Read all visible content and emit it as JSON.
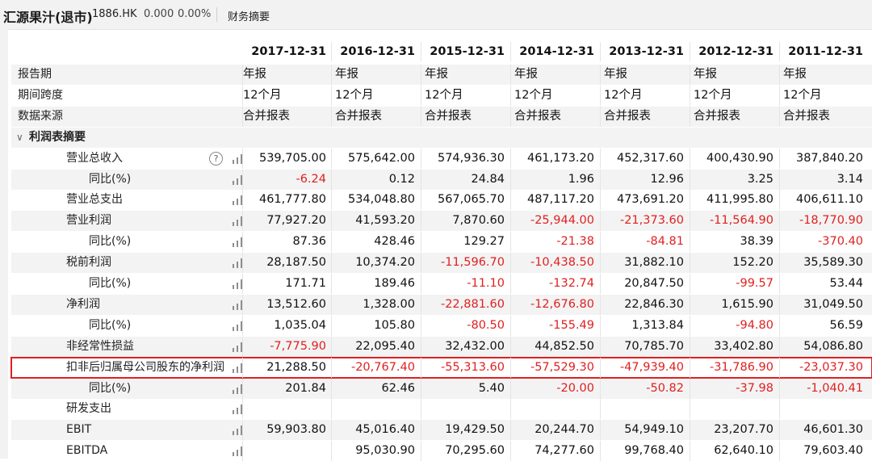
{
  "header": {
    "title": "汇源果汁(退市)",
    "code": "1886.HK",
    "price": "0.000",
    "change_pct": "0.00%",
    "tab": "财务摘要"
  },
  "columns": [
    "2017-12-31",
    "2016-12-31",
    "2015-12-31",
    "2014-12-31",
    "2013-12-31",
    "2012-12-31",
    "2011-12-31"
  ],
  "meta_rows": [
    {
      "label": "报告期",
      "values": [
        "年报",
        "年报",
        "年报",
        "年报",
        "年报",
        "年报",
        "年报"
      ]
    },
    {
      "label": "期间跨度",
      "values": [
        "12个月",
        "12个月",
        "12个月",
        "12个月",
        "12个月",
        "12个月",
        "12个月"
      ]
    },
    {
      "label": "数据来源",
      "values": [
        "合并报表",
        "合并报表",
        "合并报表",
        "合并报表",
        "合并报表",
        "合并报表",
        "合并报表"
      ]
    }
  ],
  "section": {
    "label": "利润表摘要",
    "icon": "chevron-down-icon"
  },
  "rows": [
    {
      "label": "营业总收入",
      "indent": 1,
      "help": true,
      "values": [
        "539,705.00",
        "575,642.00",
        "574,936.30",
        "461,173.20",
        "452,317.60",
        "400,430.90",
        "387,840.20"
      ]
    },
    {
      "label": "同比(%)",
      "indent": 2,
      "values": [
        "-6.24",
        "0.12",
        "24.84",
        "1.96",
        "12.96",
        "3.25",
        "3.14"
      ]
    },
    {
      "label": "营业总支出",
      "indent": 1,
      "values": [
        "461,777.80",
        "534,048.80",
        "567,065.70",
        "487,117.20",
        "473,691.20",
        "411,995.80",
        "406,611.10"
      ]
    },
    {
      "label": "营业利润",
      "indent": 1,
      "values": [
        "77,927.20",
        "41,593.20",
        "7,870.60",
        "-25,944.00",
        "-21,373.60",
        "-11,564.90",
        "-18,770.90"
      ]
    },
    {
      "label": "同比(%)",
      "indent": 2,
      "values": [
        "87.36",
        "428.46",
        "129.27",
        "-21.38",
        "-84.81",
        "38.39",
        "-370.40"
      ]
    },
    {
      "label": "税前利润",
      "indent": 1,
      "values": [
        "28,187.50",
        "10,374.20",
        "-11,596.70",
        "-10,438.50",
        "31,882.10",
        "152.20",
        "35,589.30"
      ]
    },
    {
      "label": "同比(%)",
      "indent": 2,
      "values": [
        "171.71",
        "189.46",
        "-11.10",
        "-132.74",
        "20,847.50",
        "-99.57",
        "53.44"
      ]
    },
    {
      "label": "净利润",
      "indent": 1,
      "values": [
        "13,512.60",
        "1,328.00",
        "-22,881.60",
        "-12,676.80",
        "22,846.30",
        "1,615.90",
        "31,049.50"
      ]
    },
    {
      "label": "同比(%)",
      "indent": 2,
      "values": [
        "1,035.04",
        "105.80",
        "-80.50",
        "-155.49",
        "1,313.84",
        "-94.80",
        "56.59"
      ]
    },
    {
      "label": "非经常性损益",
      "indent": 1,
      "values": [
        "-7,775.90",
        "22,095.40",
        "32,432.00",
        "44,852.50",
        "70,785.70",
        "33,402.80",
        "54,086.80"
      ]
    },
    {
      "label": "扣非后归属母公司股东的净利润",
      "indent": 1,
      "highlight": true,
      "values": [
        "21,288.50",
        "-20,767.40",
        "-55,313.60",
        "-57,529.30",
        "-47,939.40",
        "-31,786.90",
        "-23,037.30"
      ]
    },
    {
      "label": "同比(%)",
      "indent": 2,
      "values": [
        "201.84",
        "62.46",
        "5.40",
        "-20.00",
        "-50.82",
        "-37.98",
        "-1,040.41"
      ]
    },
    {
      "label": "研发支出",
      "indent": 1,
      "values": [
        "",
        "",
        "",
        "",
        "",
        "",
        ""
      ]
    },
    {
      "label": "EBIT",
      "indent": 1,
      "values": [
        "59,903.80",
        "45,016.40",
        "19,429.50",
        "20,244.70",
        "54,949.10",
        "23,207.70",
        "46,601.30"
      ]
    },
    {
      "label": "EBITDA",
      "indent": 1,
      "values": [
        "",
        "95,030.90",
        "70,295.60",
        "74,277.60",
        "99,768.40",
        "62,640.10",
        "79,603.40"
      ]
    }
  ],
  "colors": {
    "negative": "#e02020",
    "highlight_border": "#e02020",
    "row_shade": "#f3f3f3",
    "topbar": "#f2f2f2"
  }
}
